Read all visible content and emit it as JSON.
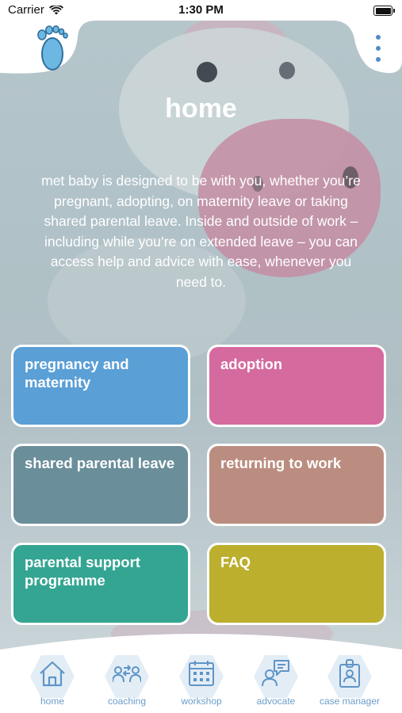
{
  "status_bar": {
    "carrier": "Carrier",
    "time": "1:30 PM"
  },
  "page": {
    "title": "home",
    "intro": "met baby is designed to be with you, whether you’re pregnant, adopting, on maternity leave or taking shared parental leave. Inside and outside of work – including while you’re on extended leave – you can access help and advice with ease, whenever you need to."
  },
  "tiles": [
    {
      "label": "pregnancy and maternity",
      "color": "#5a9fd6"
    },
    {
      "label": "adoption",
      "color": "#d56a9f"
    },
    {
      "label": "shared parental leave",
      "color": "#6a8e9a"
    },
    {
      "label": "returning to work",
      "color": "#bb8d80"
    },
    {
      "label": "parental support programme",
      "color": "#34a592"
    },
    {
      "label": "FAQ",
      "color": "#bbaf2d"
    }
  ],
  "nav": [
    {
      "label": "home",
      "icon": "home-icon"
    },
    {
      "label": "coaching",
      "icon": "coaching-icon"
    },
    {
      "label": "workshop",
      "icon": "calendar-icon"
    },
    {
      "label": "advocate",
      "icon": "advocate-icon"
    },
    {
      "label": "case manager",
      "icon": "id-badge-icon"
    }
  ],
  "colors": {
    "accent": "#4f8dc4",
    "nav_text": "#6a9dc9",
    "hex_bg": "#e3edf6"
  }
}
